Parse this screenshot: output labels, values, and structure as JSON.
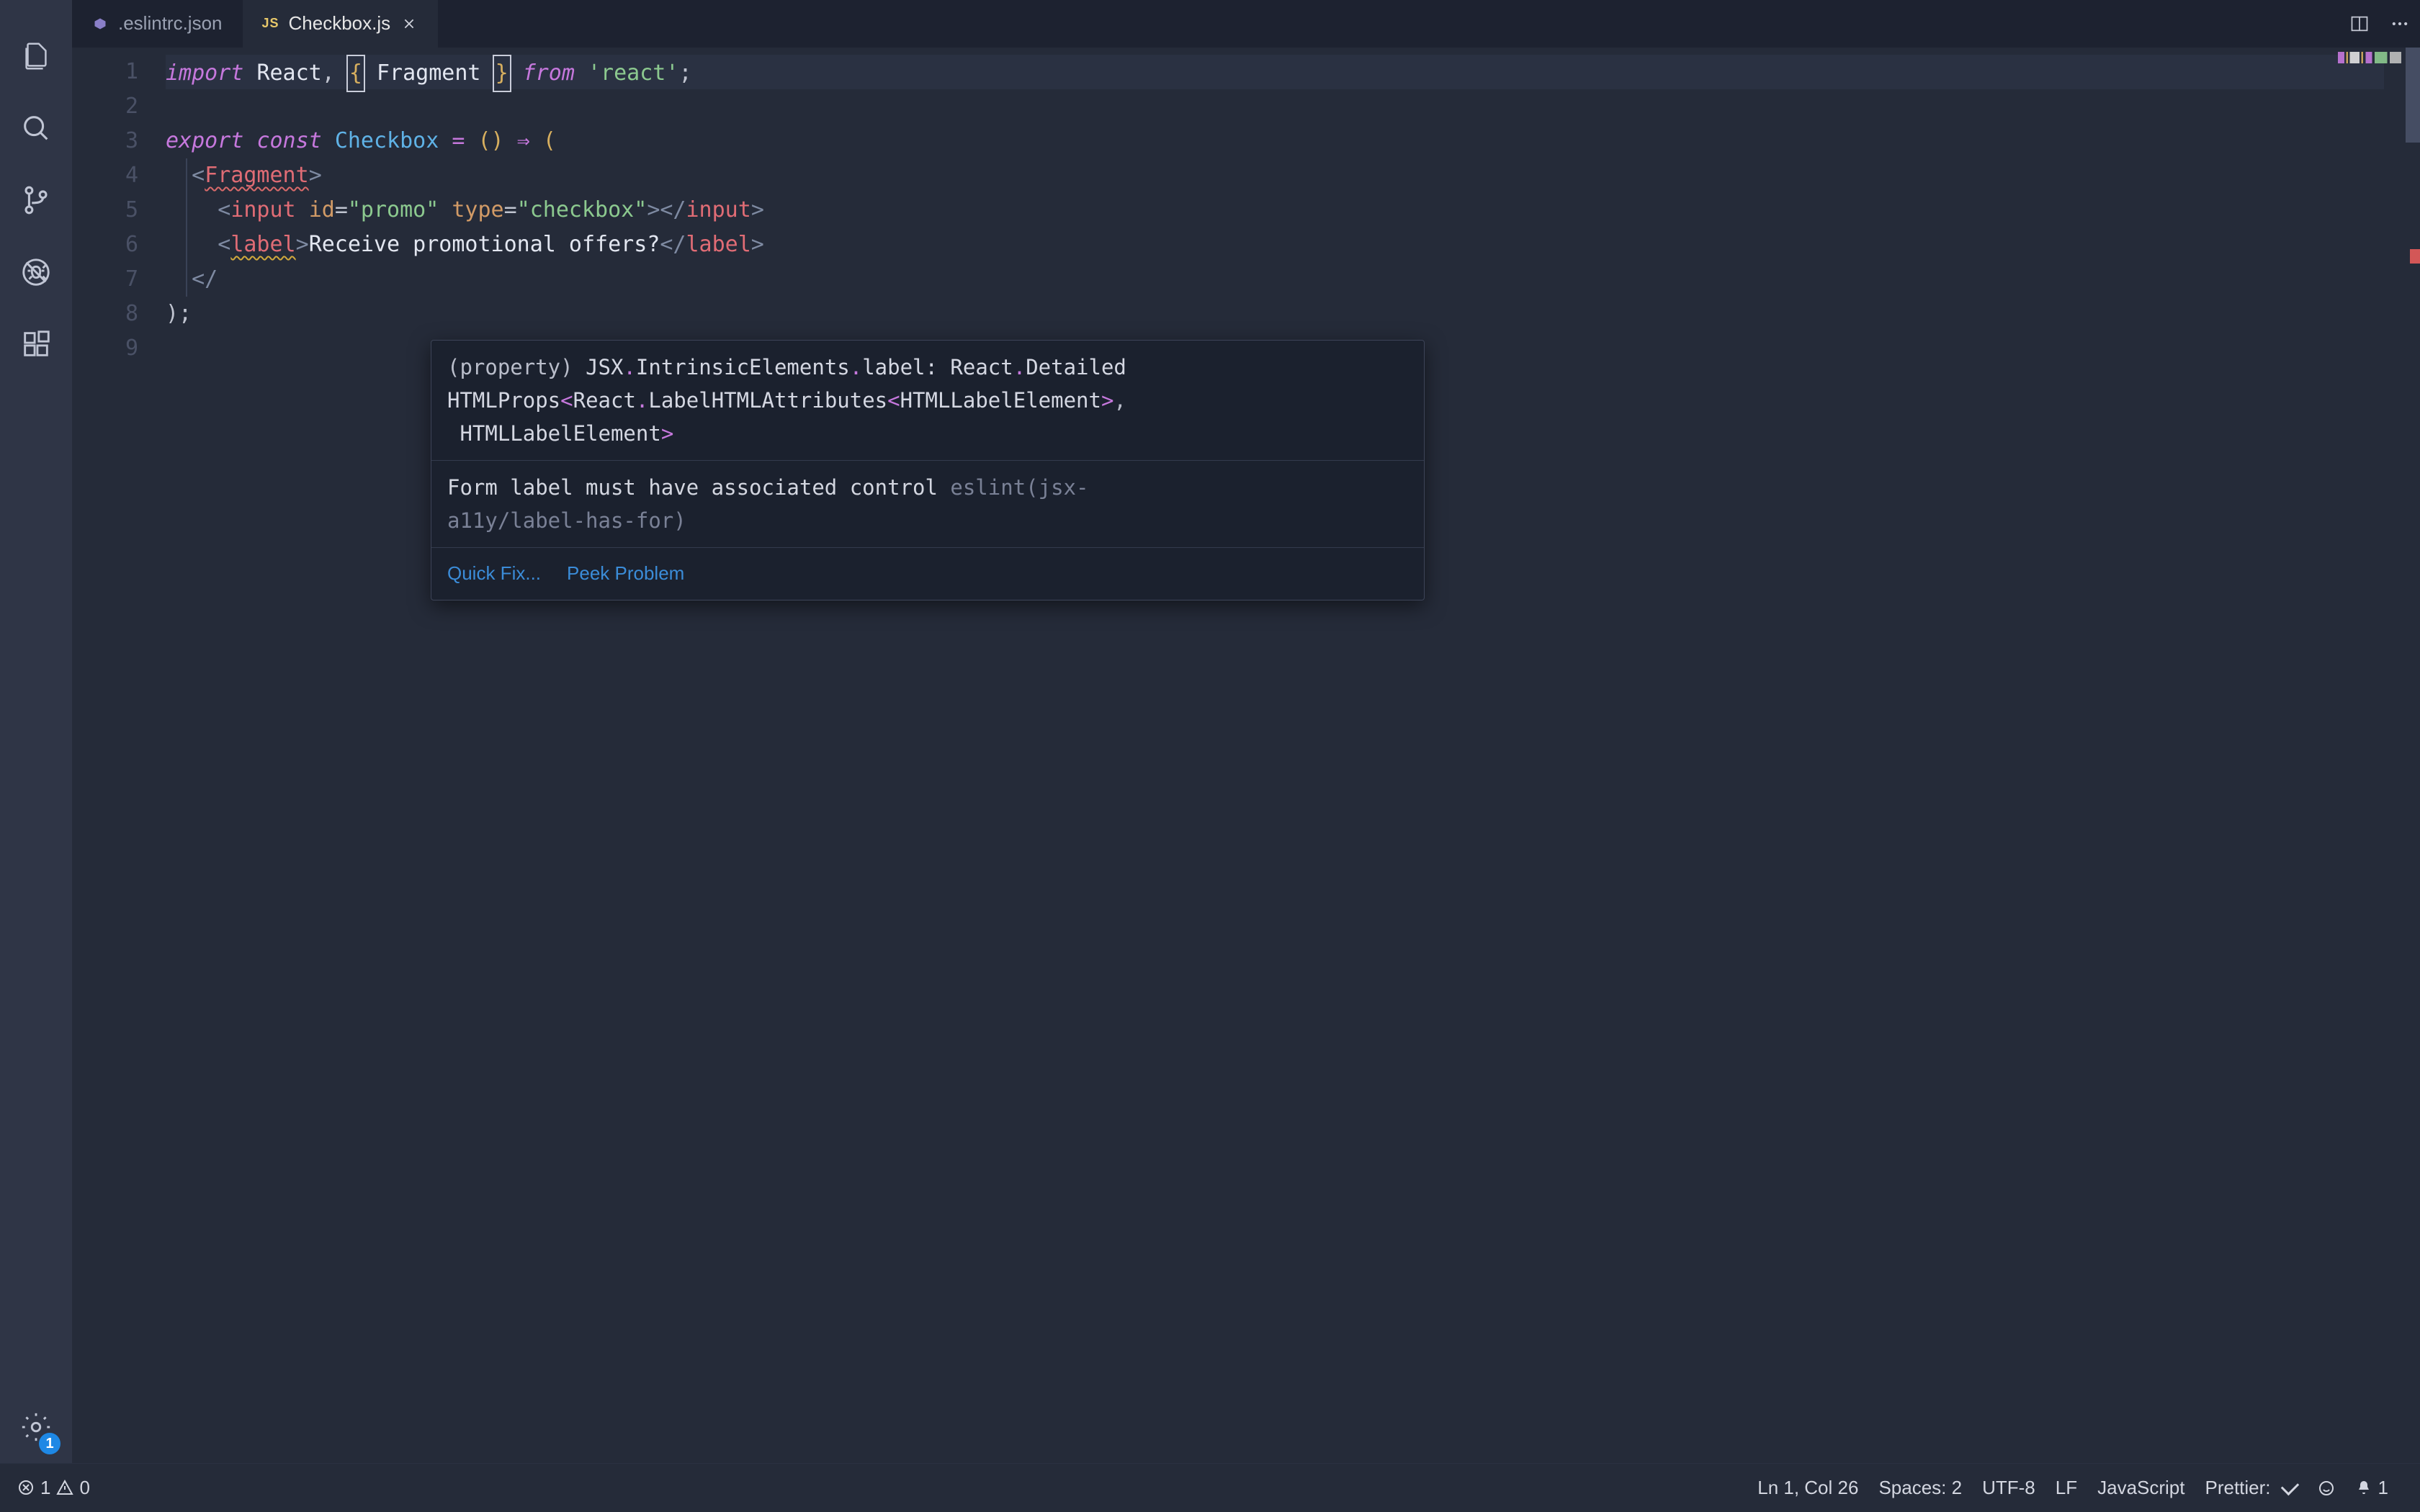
{
  "activity": {
    "settings_badge": "1"
  },
  "tabs": [
    {
      "icon": "eslint",
      "label": ".eslintrc.json",
      "active": false,
      "dirty": false
    },
    {
      "icon": "js",
      "label": "Checkbox.js",
      "active": true,
      "dirty": false
    }
  ],
  "gutter": [
    "1",
    "2",
    "3",
    "4",
    "5",
    "6",
    "7",
    "8",
    "9"
  ],
  "code": {
    "l1": {
      "import": "import",
      "react": "React",
      "fragment": "Fragment",
      "from": "from",
      "str": "'react'"
    },
    "l3": {
      "export": "export",
      "const": "const",
      "name": "Checkbox"
    },
    "l4": {
      "fragment": "Fragment"
    },
    "l5": {
      "input": "input",
      "id_attr": "id",
      "id_val": "\"promo\"",
      "type_attr": "type",
      "type_val": "\"checkbox\""
    },
    "l6": {
      "label": "label",
      "text": "Receive promotional offers?"
    },
    "l7": {
      "close_start": "</"
    },
    "l8": {
      "close": ");"
    }
  },
  "hover": {
    "sig_open": "(property) ",
    "sig_rest": "JSX.IntrinsicElements.label: React.DetailedHTMLProps<React.LabelHTMLAttributes<HTMLLabelElement>, HTMLLabelElement>",
    "msg": "Form label must have associated control",
    "src": "eslint(jsx-a11y/label-has-for)",
    "actions": {
      "quickfix": "Quick Fix...",
      "peek": "Peek Problem"
    }
  },
  "status": {
    "errors": "1",
    "warnings": "0",
    "cursor": "Ln 1, Col 26",
    "spaces": "Spaces: 2",
    "encoding": "UTF-8",
    "eol": "LF",
    "lang": "JavaScript",
    "prettier": "Prettier:",
    "bell": "1"
  }
}
